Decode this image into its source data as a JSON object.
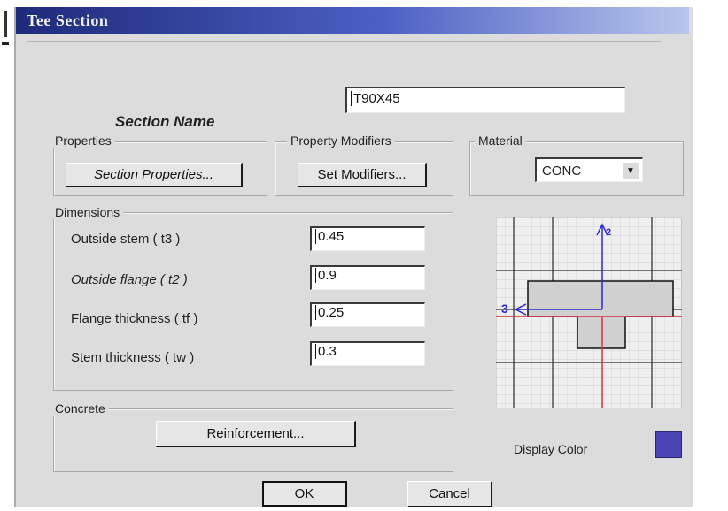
{
  "window": {
    "title": "Tee Section"
  },
  "section_name": {
    "label": "Section Name",
    "value": "T90X45"
  },
  "properties": {
    "group_label": "Properties",
    "button_label": "Section Properties..."
  },
  "modifiers": {
    "group_label": "Property Modifiers",
    "button_label": "Set Modifiers..."
  },
  "material": {
    "group_label": "Material",
    "selected": "CONC"
  },
  "dimensions": {
    "group_label": "Dimensions",
    "rows": [
      {
        "label": "Outside stem  ( t3 )",
        "value": "0.45"
      },
      {
        "label": "Outside flange  ( t2 )",
        "value": "0.9"
      },
      {
        "label": "Flange thickness  ( tf )",
        "value": "0.25"
      },
      {
        "label": "Stem thickness  ( tw )",
        "value": "0.3"
      }
    ]
  },
  "concrete": {
    "group_label": "Concrete",
    "button_label": "Reinforcement..."
  },
  "preview": {
    "axis_3_label": "3",
    "axis_2_label": "2"
  },
  "display_color": {
    "label": "Display Color",
    "color": "#4a44b4"
  },
  "buttons": {
    "ok": "OK",
    "cancel": "Cancel"
  }
}
